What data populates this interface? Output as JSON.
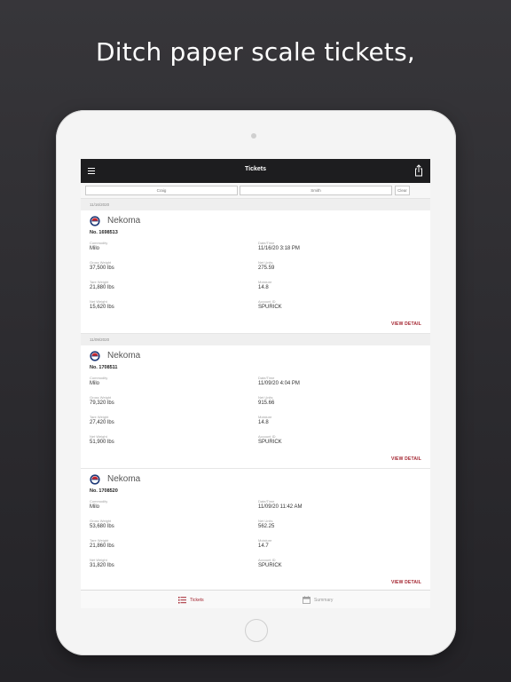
{
  "headline": "Ditch paper scale tickets,",
  "nav": {
    "title": "Tickets",
    "menu_icon": "hamburger-menu-icon",
    "share_icon": "share-icon"
  },
  "search": {
    "first_placeholder": "Craig",
    "last_placeholder": "Smith",
    "clear_label": "Clear"
  },
  "tickets": [
    {
      "date_header": "11/16/2020",
      "site": "Nekoma",
      "number": "No. 1698513",
      "commodity_label": "Commodity",
      "commodity": "Milo",
      "datetime_label": "Date/Time",
      "datetime": "11/16/20 3:18 PM",
      "gross_label": "Gross Weight",
      "gross": "37,500 lbs",
      "net_units_label": "Net Units",
      "net_units": "275.59",
      "tare_label": "Tare Weight",
      "tare": "21,880 lbs",
      "moisture_label": "Moisture",
      "moisture": "14.8",
      "net_weight_label": "Net Weight",
      "net_weight": "15,620 lbs",
      "account_label": "Account ID",
      "account": "SPURICK",
      "detail_label": "VIEW DETAIL"
    },
    {
      "date_header": "11/09/2020",
      "site": "Nekoma",
      "number": "No. 1708511",
      "commodity_label": "Commodity",
      "commodity": "Milo",
      "datetime_label": "Date/Time",
      "datetime": "11/09/20 4:04 PM",
      "gross_label": "Gross Weight",
      "gross": "79,320 lbs",
      "net_units_label": "Net Units",
      "net_units": "915.66",
      "tare_label": "Tare Weight",
      "tare": "27,420 lbs",
      "moisture_label": "Moisture",
      "moisture": "14.8",
      "net_weight_label": "Net Weight",
      "net_weight": "51,900 lbs",
      "account_label": "Account ID",
      "account": "SPURICK",
      "detail_label": "VIEW DETAIL"
    },
    {
      "date_header": "",
      "site": "Nekoma",
      "number": "No. 1708520",
      "commodity_label": "Commodity",
      "commodity": "Milo",
      "datetime_label": "Date/Time",
      "datetime": "11/09/20 11:42 AM",
      "gross_label": "Gross Weight",
      "gross": "53,680 lbs",
      "net_units_label": "Net Units",
      "net_units": "562.25",
      "tare_label": "Tare Weight",
      "tare": "21,860 lbs",
      "moisture_label": "Moisture",
      "moisture": "14.7",
      "net_weight_label": "Net Weight",
      "net_weight": "31,820 lbs",
      "account_label": "Account ID",
      "account": "SPURICK",
      "detail_label": "VIEW DETAIL"
    }
  ],
  "tabs": {
    "tickets_label": "Tickets",
    "tickets_icon": "list-icon",
    "summary_label": "Summary",
    "summary_icon": "calendar-icon"
  },
  "colors": {
    "accent": "#a3242f",
    "nav_bg": "#1d1d1f",
    "background": "#2b2a2e"
  }
}
